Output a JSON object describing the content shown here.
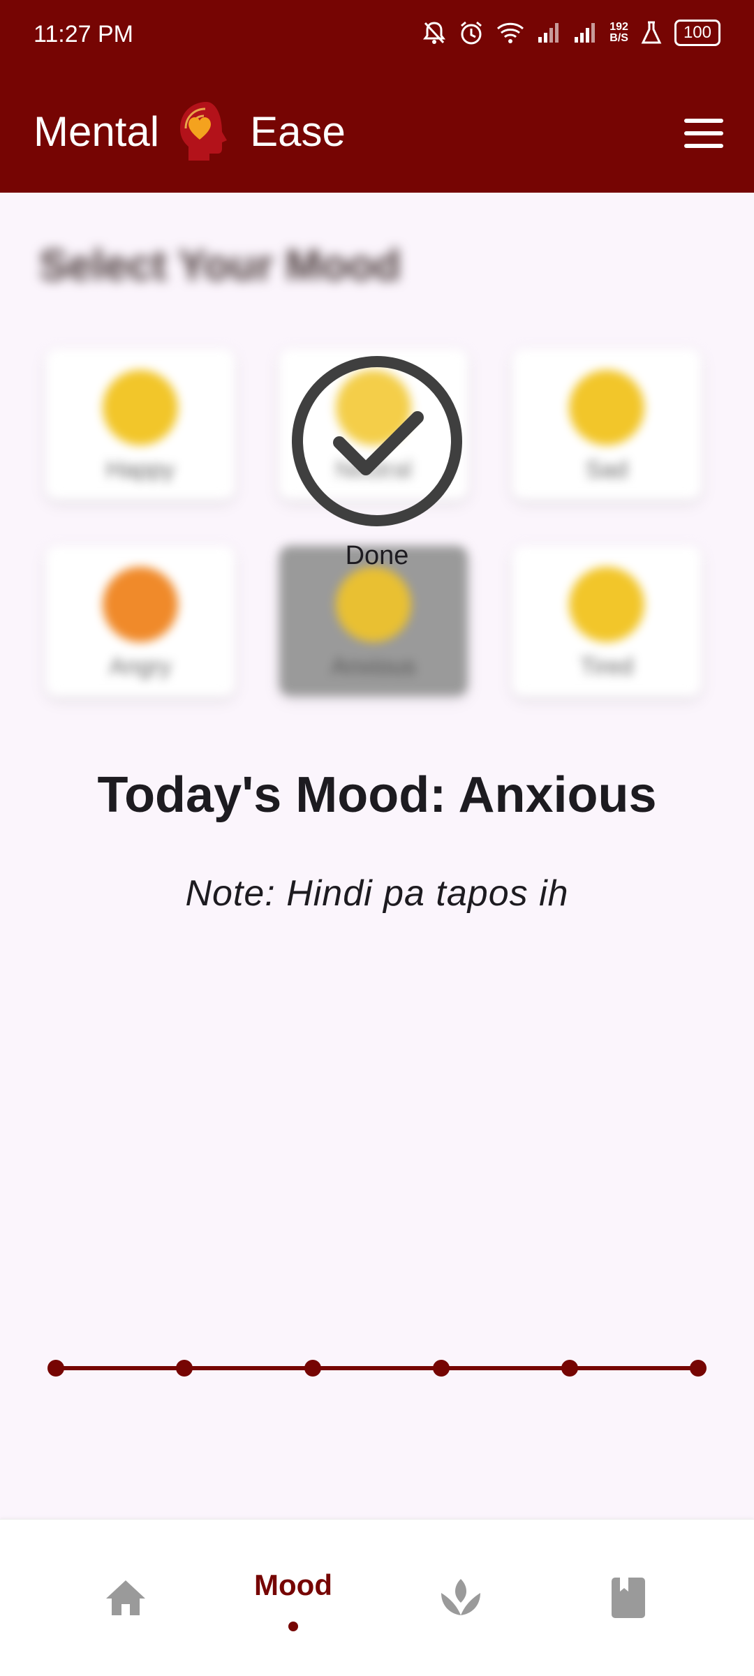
{
  "status_bar": {
    "time": "11:27 PM",
    "battery": "100",
    "speed_value": "192",
    "speed_unit": "B/S"
  },
  "app": {
    "name_left": "Mental",
    "name_right": "Ease"
  },
  "mood_section": {
    "title": "Select Your Mood",
    "moods": [
      {
        "label": "Happy",
        "color": "#f2c62a"
      },
      {
        "label": "Neutral",
        "color": "#f2c62a"
      },
      {
        "label": "Sad",
        "color": "#f2c62a"
      },
      {
        "label": "Angry",
        "color": "#f08a2a"
      },
      {
        "label": "Anxious",
        "color": "#e9c032",
        "selected": true
      },
      {
        "label": "Tired",
        "color": "#f2c62a"
      }
    ]
  },
  "overlay": {
    "label": "Done"
  },
  "today": {
    "text": "Today's Mood: Anxious"
  },
  "note": {
    "text": "Note: Hindi pa tapos ih"
  },
  "bottom_nav": {
    "items": [
      {
        "label": "Home",
        "icon": "home-icon"
      },
      {
        "label": "Mood",
        "icon": "mood-icon",
        "active": true
      },
      {
        "label": "Meditate",
        "icon": "lotus-icon"
      },
      {
        "label": "Journal",
        "icon": "book-icon"
      }
    ]
  },
  "colors": {
    "primary": "#760503",
    "background": "#fbf5fc"
  }
}
